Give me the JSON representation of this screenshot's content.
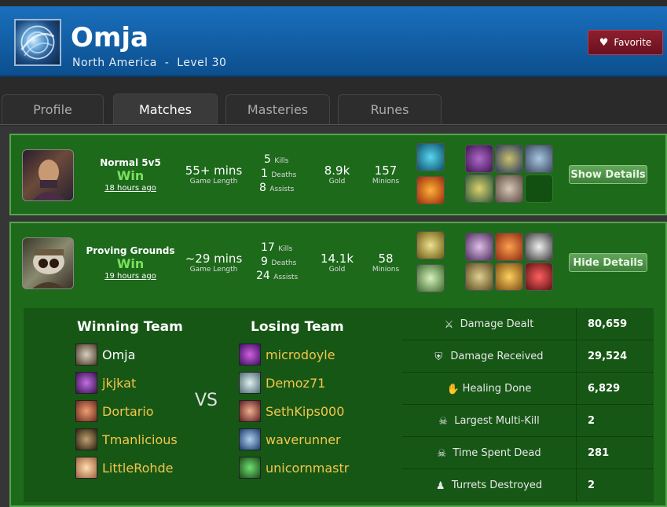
{
  "summoner": {
    "name": "Omja",
    "region": "North America",
    "separator": "-",
    "level": "Level 30",
    "favorite_label": "Favorite"
  },
  "tabs": [
    {
      "label": "Profile",
      "active": false
    },
    {
      "label": "Matches",
      "active": true
    },
    {
      "label": "Masteries",
      "active": false
    },
    {
      "label": "Runes",
      "active": false
    }
  ],
  "matches": [
    {
      "mode": "Normal 5v5",
      "result": "Win",
      "ago": "18 hours ago",
      "length": "55+ mins",
      "length_label": "Game Length",
      "kills": "5",
      "kills_label": "Kills",
      "deaths": "1",
      "deaths_label": "Deaths",
      "assists": "8",
      "assists_label": "Assists",
      "gold": "8.9k",
      "gold_label": "Gold",
      "minions": "157",
      "minions_label": "Minions",
      "button": "Show Details"
    },
    {
      "mode": "Proving Grounds",
      "result": "Win",
      "ago": "19 hours ago",
      "length": "~29 mins",
      "length_label": "Game Length",
      "kills": "17",
      "kills_label": "Kills",
      "deaths": "9",
      "deaths_label": "Deaths",
      "assists": "24",
      "assists_label": "Assists",
      "gold": "14.1k",
      "gold_label": "Gold",
      "minions": "58",
      "minions_label": "Minions",
      "button": "Hide Details"
    }
  ],
  "details": {
    "winning_team_label": "Winning Team",
    "losing_team_label": "Losing Team",
    "vs": "VS",
    "winning_team": [
      "Omja",
      "jkjkat",
      "Dortario",
      "Tmanlicious",
      "LittleRohde"
    ],
    "losing_team": [
      "microdoyle",
      "Demoz71",
      "SethKips000",
      "waverunner",
      "unicornmastr"
    ],
    "stats": [
      {
        "label": "Damage Dealt",
        "value": "80,659",
        "icon": "sword-icon"
      },
      {
        "label": "Damage Received",
        "value": "29,524",
        "icon": "shield-icon"
      },
      {
        "label": "Healing Done",
        "value": "6,829",
        "icon": "hand-icon"
      },
      {
        "label": "Largest Multi-Kill",
        "value": "2",
        "icon": "skull-group-icon"
      },
      {
        "label": "Time Spent Dead",
        "value": "281",
        "icon": "skull-icon"
      },
      {
        "label": "Turrets Destroyed",
        "value": "2",
        "icon": "turret-icon"
      }
    ]
  },
  "colors": {
    "header": "#1a6fbd",
    "panel_green": "#1d6a1b",
    "win_green": "#7be05f",
    "name_gold": "#f3c64a",
    "favorite_red": "#8d1f2e"
  }
}
